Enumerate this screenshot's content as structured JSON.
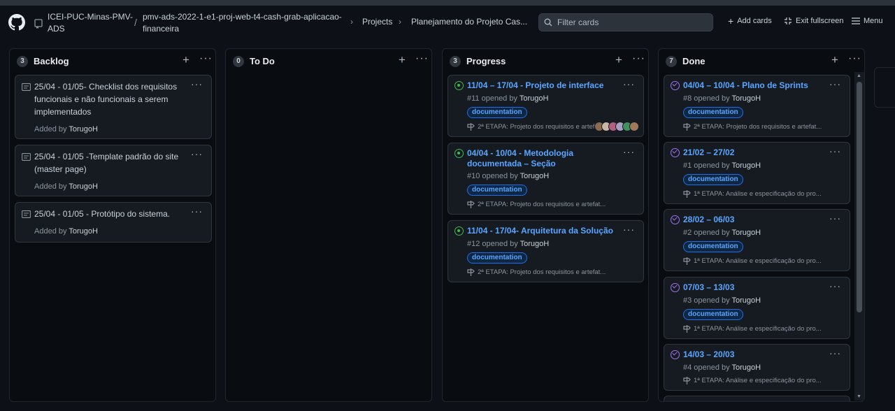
{
  "header": {
    "owner": "ICEI-PUC-Minas-PMV-ADS",
    "separator": "/",
    "repo": "pmv-ads-2022-1-e1-proj-web-t4-cash-grab-aplicacao-financeira",
    "breadcrumbs": [
      "Projects",
      "Planejamento do Projeto Cas..."
    ],
    "filter_placeholder": "Filter cards",
    "add_cards": "Add cards",
    "exit_fullscreen": "Exit fullscreen",
    "menu": "Menu"
  },
  "columns": [
    {
      "title": "Backlog",
      "count": "3",
      "cards": [
        {
          "text": "25/04 - 01/05- Checklist dos requisitos funcionais e não funcionais a serem implementados",
          "added_prefix": "Added by",
          "author": "TorugoH"
        },
        {
          "text": "25/04 - 01/05 -Template padrão do site (master page)",
          "added_prefix": "Added by",
          "author": "TorugoH"
        },
        {
          "text": "25/04 - 01/05 - Protótipo do sistema.",
          "added_prefix": "Added by",
          "author": "TorugoH"
        }
      ]
    },
    {
      "title": "To Do",
      "count": "0",
      "cards": []
    },
    {
      "title": "Progress",
      "count": "3",
      "cards": [
        {
          "title": "11/04 – 17/04 - Projeto de interface",
          "number": "#11 opened by",
          "author": "TorugoH",
          "label": "documentation",
          "milestone": "2ª ETAPA: Projeto dos requisitos e artef..."
        },
        {
          "title": "04/04 - 10/04 - Metodologia documentada – Seção",
          "number": "#10 opened by",
          "author": "TorugoH",
          "label": "documentation",
          "milestone": "2ª ETAPA: Projeto dos requisitos e artefat..."
        },
        {
          "title": "11/04 - 17/04- Arquitetura da Solução",
          "number": "#12 opened by",
          "author": "TorugoH",
          "label": "documentation",
          "milestone": "2ª ETAPA: Projeto dos requisitos e artefat..."
        }
      ]
    },
    {
      "title": "Done",
      "count": "7",
      "cards": [
        {
          "title": "04/04 – 10/04 - Plano de Sprints",
          "number": "#8 opened by",
          "author": "TorugoH",
          "label": "documentation",
          "milestone": "2ª ETAPA: Projeto dos requisitos e artefat..."
        },
        {
          "title": "21/02 – 27/02",
          "number": "#1 opened by",
          "author": "TorugoH",
          "label": "documentation",
          "milestone": "1ª ETAPA: Análise e especificação do pro..."
        },
        {
          "title": "28/02 – 06/03",
          "number": "#2 opened by",
          "author": "TorugoH",
          "label": "documentation",
          "milestone": "1ª ETAPA: Análise e especificação do pro..."
        },
        {
          "title": "07/03 – 13/03",
          "number": "#3 opened by",
          "author": "TorugoH",
          "label": "documentation",
          "milestone": "1ª ETAPA: Análise e especificação do pro..."
        },
        {
          "title": "14/03 – 20/03",
          "number": "#4 opened by",
          "author": "TorugoH",
          "milestone": "1ª ETAPA: Análise e especificação do pro..."
        }
      ]
    }
  ],
  "colors": {
    "background": "#0d1117",
    "link": "#58a6ff",
    "open": "#3fb950",
    "closed": "#a371f7"
  }
}
